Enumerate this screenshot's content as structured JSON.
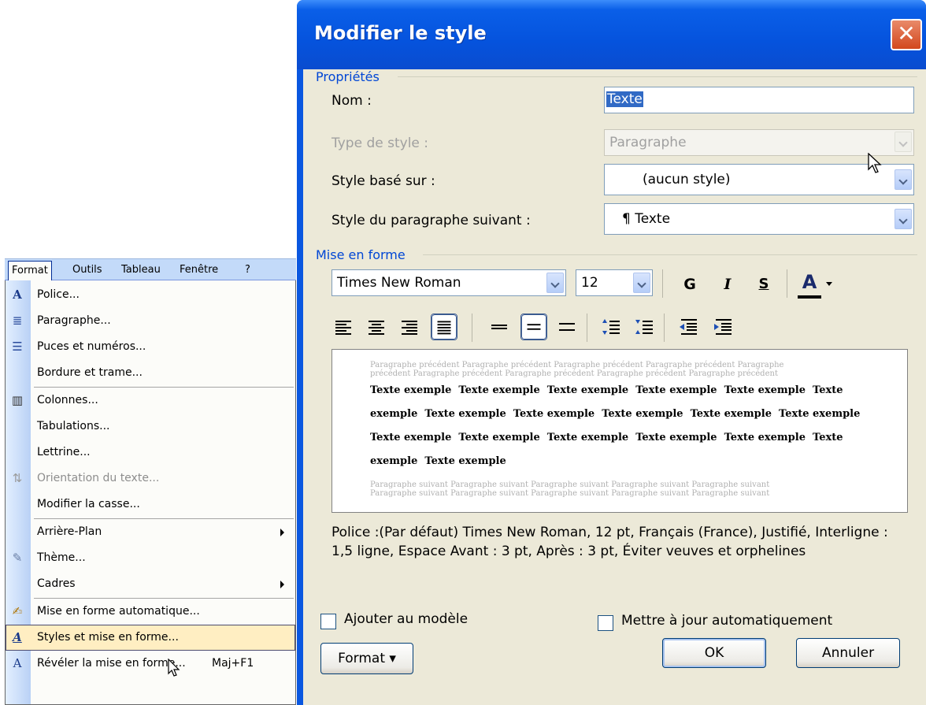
{
  "menubar": {
    "items": [
      "Format",
      "Outils",
      "Tableau",
      "Fenêtre",
      "?"
    ]
  },
  "format_menu": {
    "items": [
      {
        "label": "Police...",
        "icon": "font-icon",
        "glyph": "A"
      },
      {
        "label": "Paragraphe...",
        "icon": "paragraph-icon",
        "glyph": "≣"
      },
      {
        "label": "Puces et numéros...",
        "icon": "bullets-icon",
        "glyph": "☰"
      },
      {
        "label": "Bordure et trame...",
        "icon": "",
        "glyph": ""
      },
      {
        "label": "Colonnes...",
        "icon": "columns-icon",
        "glyph": "▥"
      },
      {
        "label": "Tabulations...",
        "icon": "",
        "glyph": ""
      },
      {
        "label": "Lettrine...",
        "icon": "",
        "glyph": ""
      },
      {
        "label": "Orientation du texte...",
        "icon": "text-direction-icon",
        "glyph": "⇅"
      },
      {
        "label": "Modifier la casse...",
        "icon": "",
        "glyph": ""
      },
      {
        "label": "Arrière-Plan",
        "icon": "",
        "glyph": ""
      },
      {
        "label": "Thème...",
        "icon": "theme-icon",
        "glyph": "✎"
      },
      {
        "label": "Cadres",
        "icon": "",
        "glyph": ""
      },
      {
        "label": "Mise en forme automatique...",
        "icon": "autoformat-icon",
        "glyph": "✍"
      },
      {
        "label": "Styles et mise en forme...",
        "icon": "styles-icon",
        "glyph": "A"
      },
      {
        "label": "Révéler la mise en forme...",
        "icon": "reveal-formatting-icon",
        "glyph": "A"
      }
    ],
    "shortcut": "Maj+F1"
  },
  "dialog": {
    "title": "Modifier le style",
    "close_glyph": "✕",
    "properties_label": "Propriétés",
    "name_label": "Nom :",
    "name_value": "Texte",
    "style_type_label": "Type de style :",
    "style_type_value": "Paragraphe",
    "based_on_label": "Style basé sur :",
    "based_on_value": "(aucun style)",
    "next_style_label": "Style du paragraphe suivant :",
    "next_style_value": "¶ Texte",
    "formatting_label": "Mise en forme",
    "font_name": "Times New Roman",
    "font_size": "12",
    "bold_glyph": "G",
    "italic_glyph": "I",
    "underline_glyph": "S",
    "font_color_glyph": "A",
    "preview_prev": "Paragraphe précédent Paragraphe précédent Paragraphe précédent Paragraphe précédent Paragraphe",
    "preview_prev2": "précédent Paragraphe précédent Paragraphe précédent Paragraphe précédent Paragraphe précédent",
    "preview_lines": [
      "Texte exemple  Texte exemple  Texte exemple  Texte exemple  Texte exemple  Texte",
      "exemple  Texte exemple  Texte exemple  Texte exemple  Texte exemple  Texte exemple",
      "Texte exemple  Texte exemple  Texte exemple  Texte exemple  Texte exemple  Texte",
      "exemple  Texte exemple"
    ],
    "preview_next": "Paragraphe suivant Paragraphe suivant Paragraphe suivant Paragraphe suivant Paragraphe suivant",
    "preview_next2": "Paragraphe suivant Paragraphe suivant Paragraphe suivant Paragraphe suivant Paragraphe suivant",
    "description": "Police :(Par défaut) Times New Roman, 12 pt, Français (France), Justifié, Interligne : 1,5 ligne, Espace Avant : 3 pt, Après : 3 pt, Éviter veuves et orphelines",
    "add_template_label": "Ajouter au modèle",
    "auto_update_label": "Mettre à jour automatiquement",
    "format_button": "Format ▾",
    "ok_button": "OK",
    "cancel_button": "Annuler"
  }
}
